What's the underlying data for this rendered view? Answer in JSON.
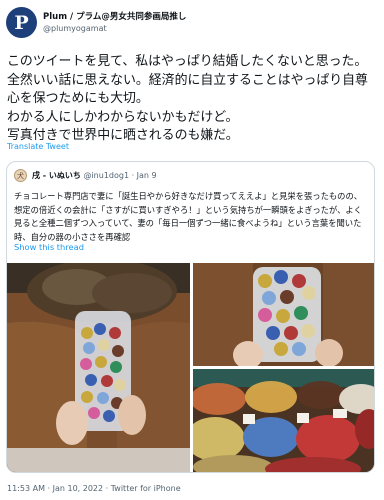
{
  "author": {
    "avatar_letter": "P",
    "display_name": "Plum / プラム@男女共同参画局推し",
    "handle": "@plumyogamat"
  },
  "tweet": {
    "text": "このツイートを見て、私はやっぱり結婚したくないと思った。全然いい話に思えない。経済的に自立することはやっぱり自尊心を保つためにも大切。\nわかる人にしかわからないかもだけど。\n写真付きで世界中に晒されるのも嫌だ。",
    "translate_label": "Translate Tweet"
  },
  "quoted": {
    "avatar_glyph": "犬",
    "display_name": "戌 - いぬいち",
    "handle": "@inu1dog1",
    "separator": "·",
    "date": "Jan 9",
    "text": "チョコレート専門店で妻に「誕生日やから好きなだけ買ってええよ」と見栄を張ったものの、想定の倍近くの会計に「さすがに買いすぎやろ！」という気持ちが一瞬頭をよぎったが、よく見ると全種二個ずつ入っていて、妻の「毎日一個ずつ一緒に食べようね」という言葉を聞いた時、自分の器の小ささを再確認",
    "show_thread_label": "Show this thread"
  },
  "footer": {
    "timestamp": "11:53 AM · Jan 10, 2022 · Twitter for iPhone"
  },
  "colors": {
    "link": "#1d9bf0",
    "secondary_text": "#536471",
    "border": "#cfd9de"
  }
}
